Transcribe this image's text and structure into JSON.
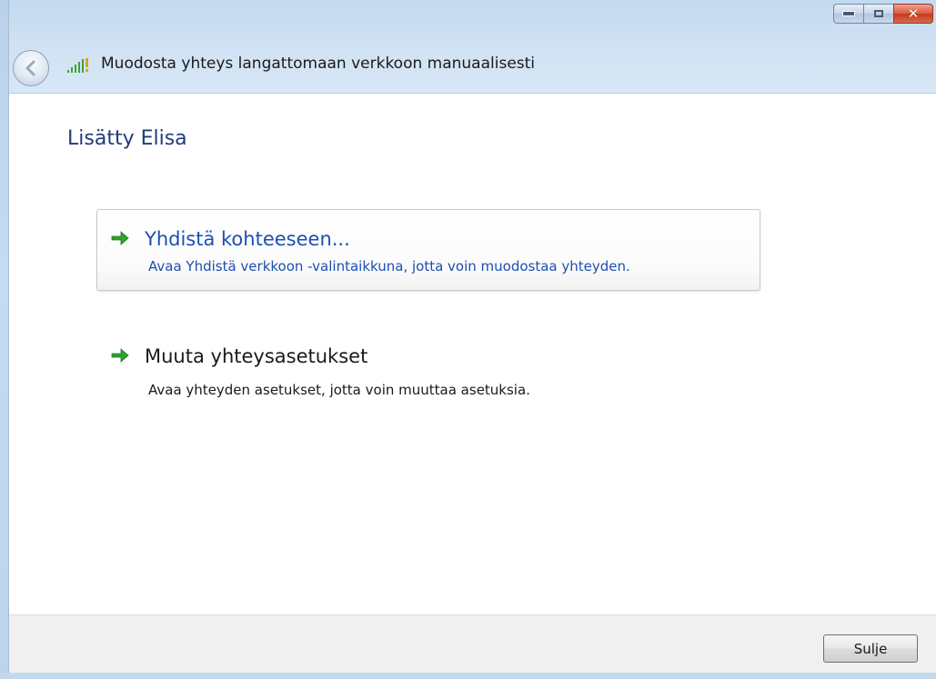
{
  "window": {
    "title": "Muodosta yhteys langattomaan verkkoon manuaalisesti",
    "caption": {
      "close_color": "#c53a1c"
    }
  },
  "content": {
    "heading": "Lisätty Elisa",
    "options": [
      {
        "title": "Yhdistä kohteeseen...",
        "description": "Avaa Yhdistä verkkoon -valintaikkuna, jotta voin muodostaa yhteyden.",
        "icon": "green-arrow-icon",
        "state": "hover"
      },
      {
        "title": "Muuta yhteysasetukset",
        "description": "Avaa yhteyden asetukset, jotta voin muuttaa asetuksia.",
        "icon": "green-arrow-icon",
        "state": "normal"
      }
    ]
  },
  "footer": {
    "close_label": "Sulje"
  },
  "colors": {
    "link_blue": "#1c50b0",
    "heading_blue": "#1f3c7a",
    "arrow_green": "#2ea32e"
  }
}
